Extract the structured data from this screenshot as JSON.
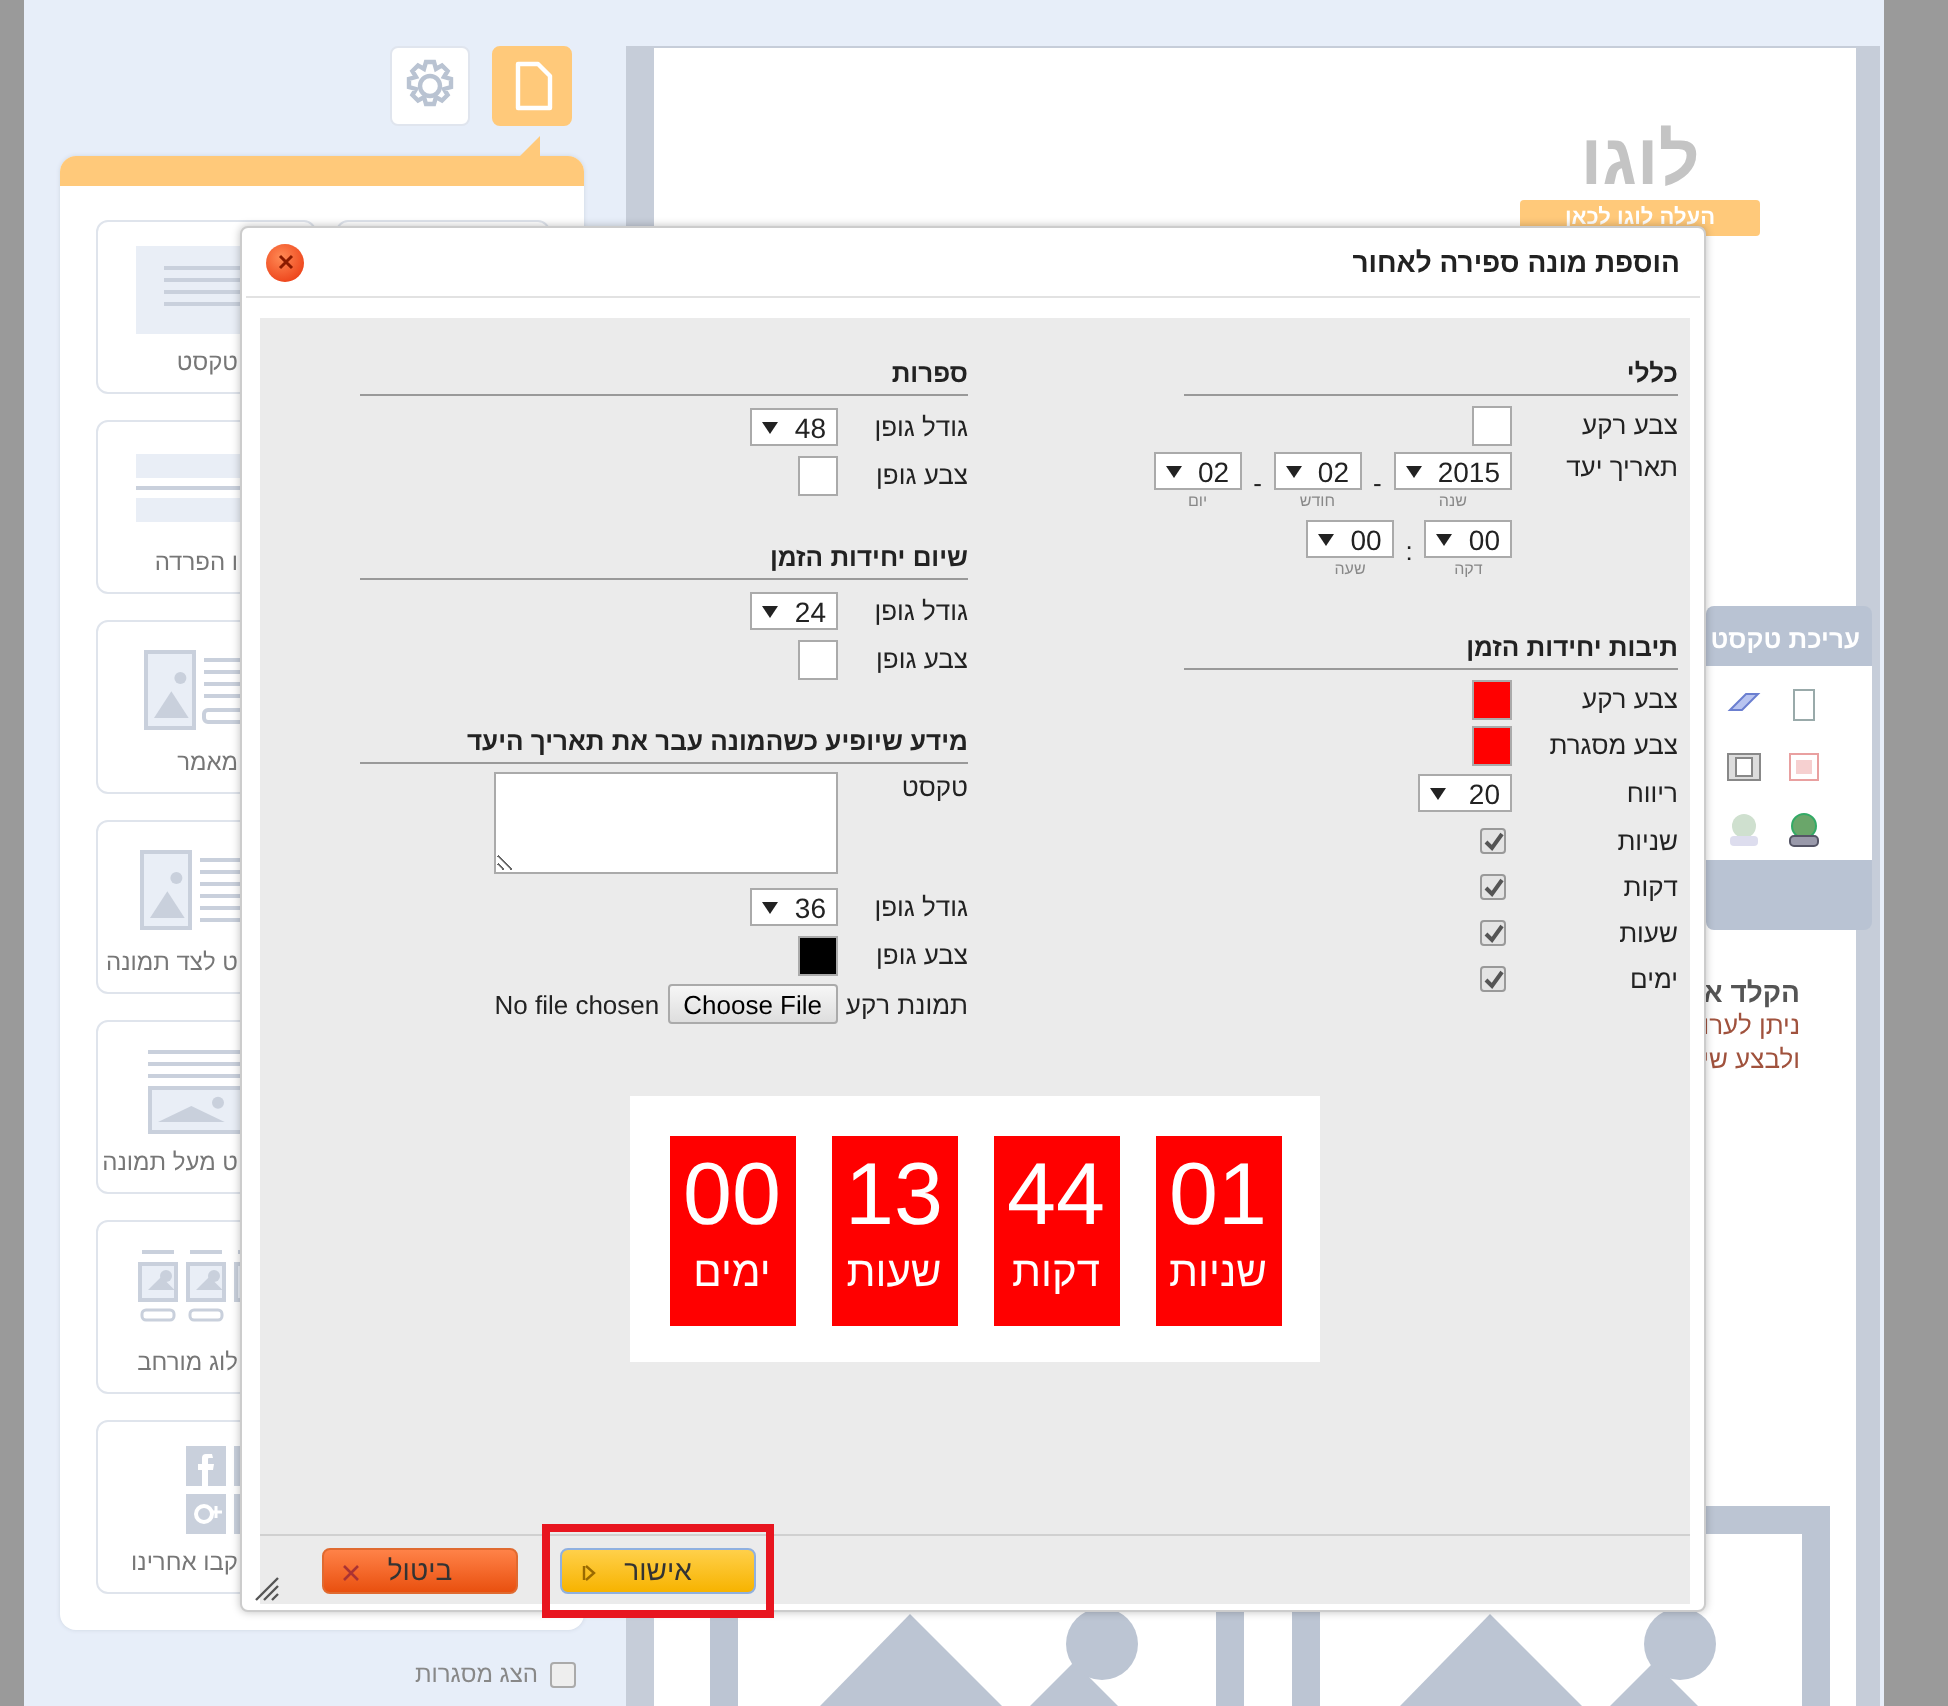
{
  "sidebar": {
    "tabs": [
      {
        "selected": false
      },
      {
        "selected": true
      }
    ],
    "widgets": [
      {
        "kind": "text",
        "label": "טקסט"
      },
      {
        "kind": "divider",
        "label": "ו הפרדה"
      },
      {
        "kind": "article",
        "label": "מאמר"
      },
      {
        "kind": "text-beside-image",
        "label": "ט לצד תמונה"
      },
      {
        "kind": "text-over-image",
        "label": "ט מעל תמונה"
      },
      {
        "kind": "blog",
        "label": "לוג מורחב"
      },
      {
        "kind": "social",
        "label": "קבו אחרינו"
      }
    ],
    "show_frames": {
      "label": "הצג מסגרות",
      "checked": false
    }
  },
  "page": {
    "logo": "לוגו",
    "logo_upload": "העלה לוגו לכאן",
    "text_toolbar": {
      "title": "עריכת טקסט"
    },
    "text_block": {
      "heading": "הקלד א",
      "lines": [
        "ניתן לערו",
        "ולבצע שי"
      ]
    }
  },
  "dialog": {
    "title": "הוספת מונה ספירה לאחור",
    "columns": [
      {
        "sections": [
          {
            "heading": "כללי",
            "rows": [
              {
                "kind": "color",
                "label": "צבע רקע",
                "color": "#ffffff"
              },
              {
                "kind": "date",
                "label": "תאריך יעד",
                "separator": "-",
                "fields": [
                  {
                    "value": "2015",
                    "caption": "שנה"
                  },
                  {
                    "value": "02",
                    "caption": "חודש"
                  },
                  {
                    "value": "02",
                    "caption": "יום"
                  }
                ]
              },
              {
                "kind": "time",
                "separator": ":",
                "fields": [
                  {
                    "value": "00",
                    "caption": "דקה"
                  },
                  {
                    "value": "00",
                    "caption": "שעה"
                  }
                ]
              }
            ]
          },
          {
            "heading": "תיבות יחידות הזמן",
            "rows": [
              {
                "kind": "color",
                "label": "צבע רקע",
                "color": "#ff0000"
              },
              {
                "kind": "color",
                "label": "צבע מסגרת",
                "color": "#ff0000"
              },
              {
                "kind": "select",
                "label": "ריווח",
                "value": "20"
              },
              {
                "kind": "checkbox",
                "label": "שניות",
                "checked": true
              },
              {
                "kind": "checkbox",
                "label": "דקות",
                "checked": true
              },
              {
                "kind": "checkbox",
                "label": "שעות",
                "checked": true
              },
              {
                "kind": "checkbox",
                "label": "ימים",
                "checked": true
              }
            ]
          }
        ]
      },
      {
        "sections": [
          {
            "heading": "ספרות",
            "rows": [
              {
                "kind": "select",
                "label": "גודל גופן",
                "value": "48"
              },
              {
                "kind": "color",
                "label": "צבע גופן",
                "color": "#ffffff"
              }
            ]
          },
          {
            "heading": "שיום יחידות הזמן",
            "rows": [
              {
                "kind": "select",
                "label": "גודל גופן",
                "value": "24"
              },
              {
                "kind": "color",
                "label": "צבע גופן",
                "color": "#ffffff"
              }
            ]
          },
          {
            "heading": "מידע שיופיע כשהמונה עבר את תאריך היעד",
            "rows": [
              {
                "kind": "textarea",
                "label": "טקסט"
              },
              {
                "kind": "select",
                "label": "גודל גופן",
                "value": "36"
              },
              {
                "kind": "color",
                "label": "צבע גופן",
                "color": "#000000"
              },
              {
                "kind": "file",
                "label": "תמונת רקע",
                "button": "Choose File",
                "status": "No file chosen"
              }
            ]
          }
        ]
      }
    ],
    "preview": {
      "units": [
        {
          "value": "01",
          "label": "שניות"
        },
        {
          "value": "44",
          "label": "דקות"
        },
        {
          "value": "13",
          "label": "שעות"
        },
        {
          "value": "00",
          "label": "ימים"
        }
      ]
    },
    "buttons": [
      {
        "kind": "confirm",
        "label": "אישור",
        "highlighted": true
      },
      {
        "kind": "cancel",
        "label": "ביטול"
      }
    ]
  }
}
